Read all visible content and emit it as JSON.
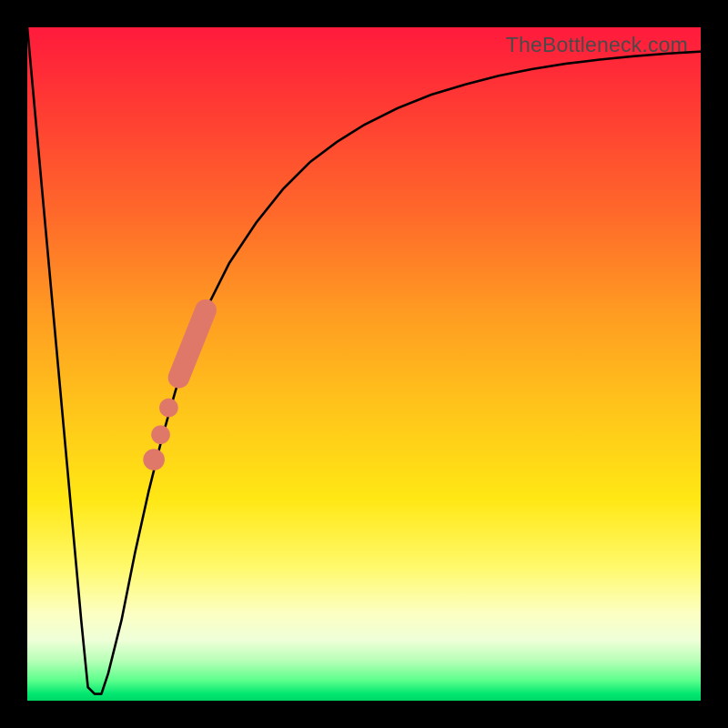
{
  "watermark": "TheBottleneck.com",
  "colors": {
    "frame": "#000000",
    "curve": "#000000",
    "marker": "#e0786a",
    "gradient_top": "#ff1a3c",
    "gradient_bottom": "#00d766"
  },
  "chart_data": {
    "type": "line",
    "title": "",
    "xlabel": "",
    "ylabel": "",
    "xlim": [
      0,
      100
    ],
    "ylim": [
      0,
      100
    ],
    "x": [
      0,
      2,
      4,
      6,
      8,
      9,
      10,
      11,
      12,
      14,
      16,
      18,
      20,
      22,
      24,
      26,
      28,
      30,
      34,
      38,
      42,
      46,
      50,
      55,
      60,
      65,
      70,
      75,
      80,
      85,
      90,
      95,
      100
    ],
    "y": [
      100,
      78,
      56,
      34,
      12,
      2,
      1,
      1,
      4,
      12,
      22,
      31,
      39,
      46,
      52,
      57,
      61,
      65,
      71,
      76,
      80,
      83,
      85.5,
      88,
      90,
      91.5,
      92.8,
      93.8,
      94.6,
      95.2,
      95.7,
      96.1,
      96.4
    ],
    "markers": [
      {
        "type": "segment",
        "x0": 22.5,
        "y0": 48,
        "x1": 26.5,
        "y1": 58,
        "width": 3.2
      },
      {
        "type": "dot",
        "x": 21.0,
        "y": 43.5,
        "r": 1.4
      },
      {
        "type": "dot",
        "x": 19.8,
        "y": 39.5,
        "r": 1.4
      },
      {
        "type": "dot",
        "x": 18.8,
        "y": 35.8,
        "r": 1.6
      }
    ],
    "annotations": []
  }
}
